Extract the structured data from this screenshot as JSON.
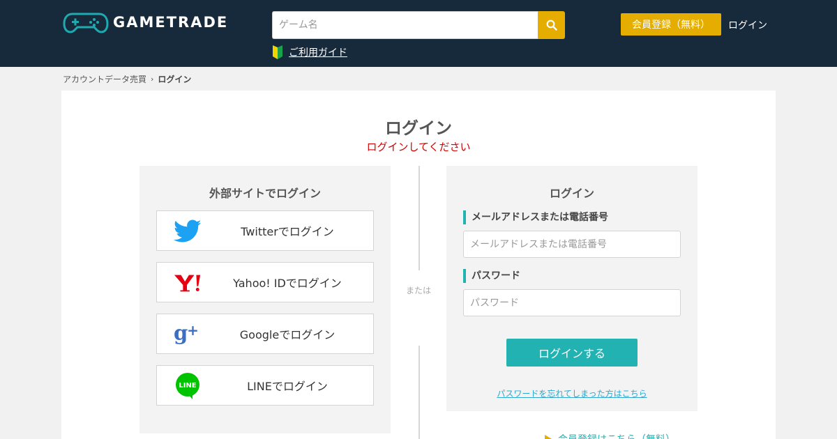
{
  "header": {
    "logo_text": "GAMETRADE",
    "search_placeholder": "ゲーム名",
    "guide_label": "ご利用ガイド",
    "register_label": "会員登録（無料）",
    "login_label": "ログイン"
  },
  "breadcrumb": {
    "items": [
      "アカウントデータ売買",
      "ログイン"
    ]
  },
  "main": {
    "title": "ログイン",
    "subtitle": "ログインしてください",
    "divider_text": "または",
    "social": {
      "title": "外部サイトでログイン",
      "buttons": [
        {
          "label": "Twitterでログイン",
          "icon": "twitter-icon"
        },
        {
          "label": "Yahoo! IDでログイン",
          "icon": "yahoo-icon"
        },
        {
          "label": "Googleでログイン",
          "icon": "google-plus-icon"
        },
        {
          "label": "LINEでログイン",
          "icon": "line-icon"
        }
      ]
    },
    "form": {
      "title": "ログイン",
      "email_label": "メールアドレスまたは電話番号",
      "email_placeholder": "メールアドレスまたは電話番号",
      "password_label": "パスワード",
      "password_placeholder": "パスワード",
      "submit_label": "ログインする",
      "forgot_label": "パスワードを忘れてしまった方はこちら"
    },
    "register_link": "会員登録はこちら（無料）"
  },
  "colors": {
    "header_bg": "#172a3c",
    "accent_yellow": "#e4ad00",
    "accent_teal": "#22b2b2",
    "error_red": "#d40000",
    "link_blue": "#2fa7cf"
  }
}
